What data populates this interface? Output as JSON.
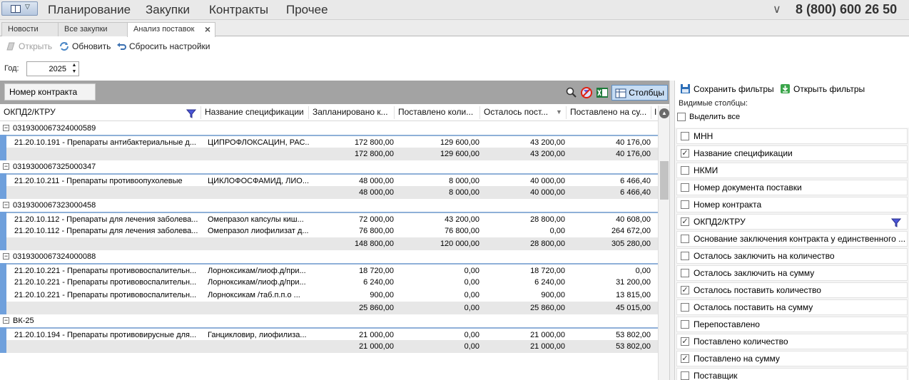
{
  "menubar": {
    "items": [
      "Планирование",
      "Закупки",
      "Контракты",
      "Прочее"
    ],
    "phone": "8 (800) 600 26 50",
    "phone_caret": "∨"
  },
  "tabs": [
    {
      "label": "Новости",
      "active": false
    },
    {
      "label": "Все закупки",
      "active": false
    },
    {
      "label": "Анализ поставок",
      "active": true,
      "close": "×"
    }
  ],
  "toolbar": {
    "open_label": "Открыть",
    "refresh_label": "Обновить",
    "reset_label": "Сбросить настройки"
  },
  "filter": {
    "year_label": "Год:",
    "year_value": "2025"
  },
  "grid": {
    "group_chip": "Номер контракта",
    "columns_button": "Столбцы",
    "columns": [
      "ОКПД2/КТРУ",
      "Название спецификации",
      "Запланировано к...",
      "Поставлено коли...",
      "Осталось пост...",
      "Поставлено на су...",
      "I"
    ],
    "groups": [
      {
        "name": "0319300067324000589",
        "rows": [
          [
            "21.20.10.191 - Препараты антибактериальные д...",
            "ЦИПРОФЛОКСАЦИН, РАС...",
            "172 800,00",
            "129 600,00",
            "43 200,00",
            "40 176,00"
          ]
        ],
        "summary": [
          "172 800,00",
          "129 600,00",
          "43 200,00",
          "40 176,00"
        ]
      },
      {
        "name": "0319300067325000347",
        "rows": [
          [
            "21.20.10.211 - Препараты противоопухолевые",
            "ЦИКЛОФОСФАМИД, ЛИО...",
            "48 000,00",
            "8 000,00",
            "40 000,00",
            "6 466,40"
          ]
        ],
        "summary": [
          "48 000,00",
          "8 000,00",
          "40 000,00",
          "6 466,40"
        ]
      },
      {
        "name": "0319300067323000458",
        "rows": [
          [
            "21.20.10.112 - Препараты для лечения заболева...",
            "Омепразол капсулы киш...",
            "72 000,00",
            "43 200,00",
            "28 800,00",
            "40 608,00"
          ],
          [
            "21.20.10.112 - Препараты для лечения заболева...",
            "Омепразол лиофилизат д...",
            "76 800,00",
            "76 800,00",
            "0,00",
            "264 672,00"
          ]
        ],
        "summary": [
          "148 800,00",
          "120 000,00",
          "28 800,00",
          "305 280,00"
        ]
      },
      {
        "name": "0319300067324000088",
        "rows": [
          [
            "21.20.10.221 - Препараты противовоспалительн...",
            "Лорноксикам/лиоф.д/при...",
            "18 720,00",
            "0,00",
            "18 720,00",
            "0,00"
          ],
          [
            "21.20.10.221 - Препараты противовоспалительн...",
            "Лорноксикам/лиоф.д/при...",
            "6 240,00",
            "0,00",
            "6 240,00",
            "31 200,00"
          ],
          [
            "21.20.10.221 - Препараты противовоспалительн...",
            "Лорноксикам /таб.п.п.о ...",
            "900,00",
            "0,00",
            "900,00",
            "13 815,00"
          ]
        ],
        "summary": [
          "25 860,00",
          "0,00",
          "25 860,00",
          "45 015,00"
        ]
      },
      {
        "name": "ВК-25",
        "rows": [
          [
            "21.20.10.194 - Препараты противовирусные для...",
            "Ганцикловир, лиофилиза...",
            "21 000,00",
            "0,00",
            "21 000,00",
            "53 802,00"
          ]
        ],
        "summary": [
          "21 000,00",
          "0,00",
          "21 000,00",
          "53 802,00"
        ]
      }
    ]
  },
  "panel": {
    "save_filters": "Сохранить фильтры",
    "open_filters": "Открыть фильтры",
    "visible_columns_label": "Видимые столбцы:",
    "select_all": "Выделить все",
    "columns": [
      {
        "label": "МНН",
        "checked": false
      },
      {
        "label": "Название спецификации",
        "checked": true
      },
      {
        "label": "НКМИ",
        "checked": false
      },
      {
        "label": "Номер документа поставки",
        "checked": false
      },
      {
        "label": "Номер контракта",
        "checked": false
      },
      {
        "label": "ОКПД2/КТРУ",
        "checked": true,
        "filter": true
      },
      {
        "label": "Основание заключения контракта у единственного ...",
        "checked": false
      },
      {
        "label": "Осталось заключить на количество",
        "checked": false
      },
      {
        "label": "Осталось заключить на сумму",
        "checked": false
      },
      {
        "label": "Осталось поставить количество",
        "checked": true
      },
      {
        "label": "Осталось поставить на сумму",
        "checked": false
      },
      {
        "label": "Перепоставлено",
        "checked": false
      },
      {
        "label": "Поставлено количество",
        "checked": true
      },
      {
        "label": "Поставлено на сумму",
        "checked": true
      },
      {
        "label": "Поставщик",
        "checked": false
      }
    ]
  },
  "colors": {
    "accent": "#6fa0dc",
    "row_border": "#8fb0d8",
    "group_bar": "#a3a3a3",
    "summary_bg": "#e7e7e7"
  }
}
